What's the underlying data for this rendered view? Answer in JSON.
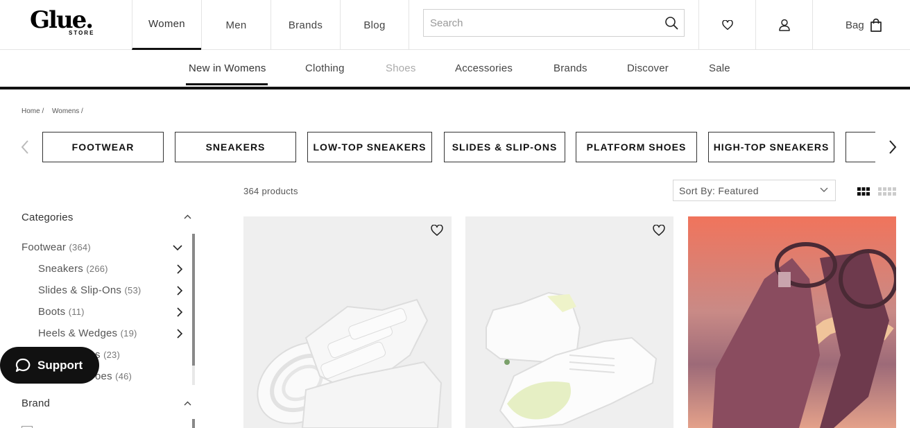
{
  "header": {
    "logo_main": "Glue.",
    "logo_sub": "STORE",
    "nav": [
      "Women",
      "Men",
      "Brands",
      "Blog"
    ],
    "active_nav": "Women",
    "search_placeholder": "Search",
    "bag_label": "Bag"
  },
  "subnav": {
    "items": [
      "New in Womens",
      "Clothing",
      "Shoes",
      "Accessories",
      "Brands",
      "Discover",
      "Sale"
    ],
    "active": "New in Womens",
    "muted": "Shoes"
  },
  "breadcrumb": [
    "Home /",
    "Womens /"
  ],
  "chips": [
    "FOOTWEAR",
    "SNEAKERS",
    "LOW-TOP SNEAKERS",
    "SLIDES & SLIP-ONS",
    "PLATFORM SHOES",
    "HIGH-TOP SNEAKERS"
  ],
  "product_count": "364 products",
  "sort_label": "Sort By: Featured",
  "sidebar": {
    "categories_title": "Categories",
    "footwear": {
      "label": "Footwear",
      "count": "(364)"
    },
    "items": [
      {
        "label": "Sneakers",
        "count": "(266)"
      },
      {
        "label": "Slides & Slip-Ons",
        "count": "(53)"
      },
      {
        "label": "Boots",
        "count": "(11)"
      },
      {
        "label": "Heels & Wedges",
        "count": "(19)"
      },
      {
        "label": "s",
        "count": "(23)"
      },
      {
        "label": "oes",
        "count": "(46)"
      }
    ],
    "brand_title": "Brand"
  },
  "support_label": "Support",
  "icons": {
    "search": "search-icon",
    "wishlist": "heart-icon",
    "account": "user-icon",
    "bag": "bag-icon",
    "support": "chat-icon"
  },
  "colors": {
    "accent": "#111111",
    "muted": "#aaaaaa",
    "border": "#e4e4e4"
  }
}
